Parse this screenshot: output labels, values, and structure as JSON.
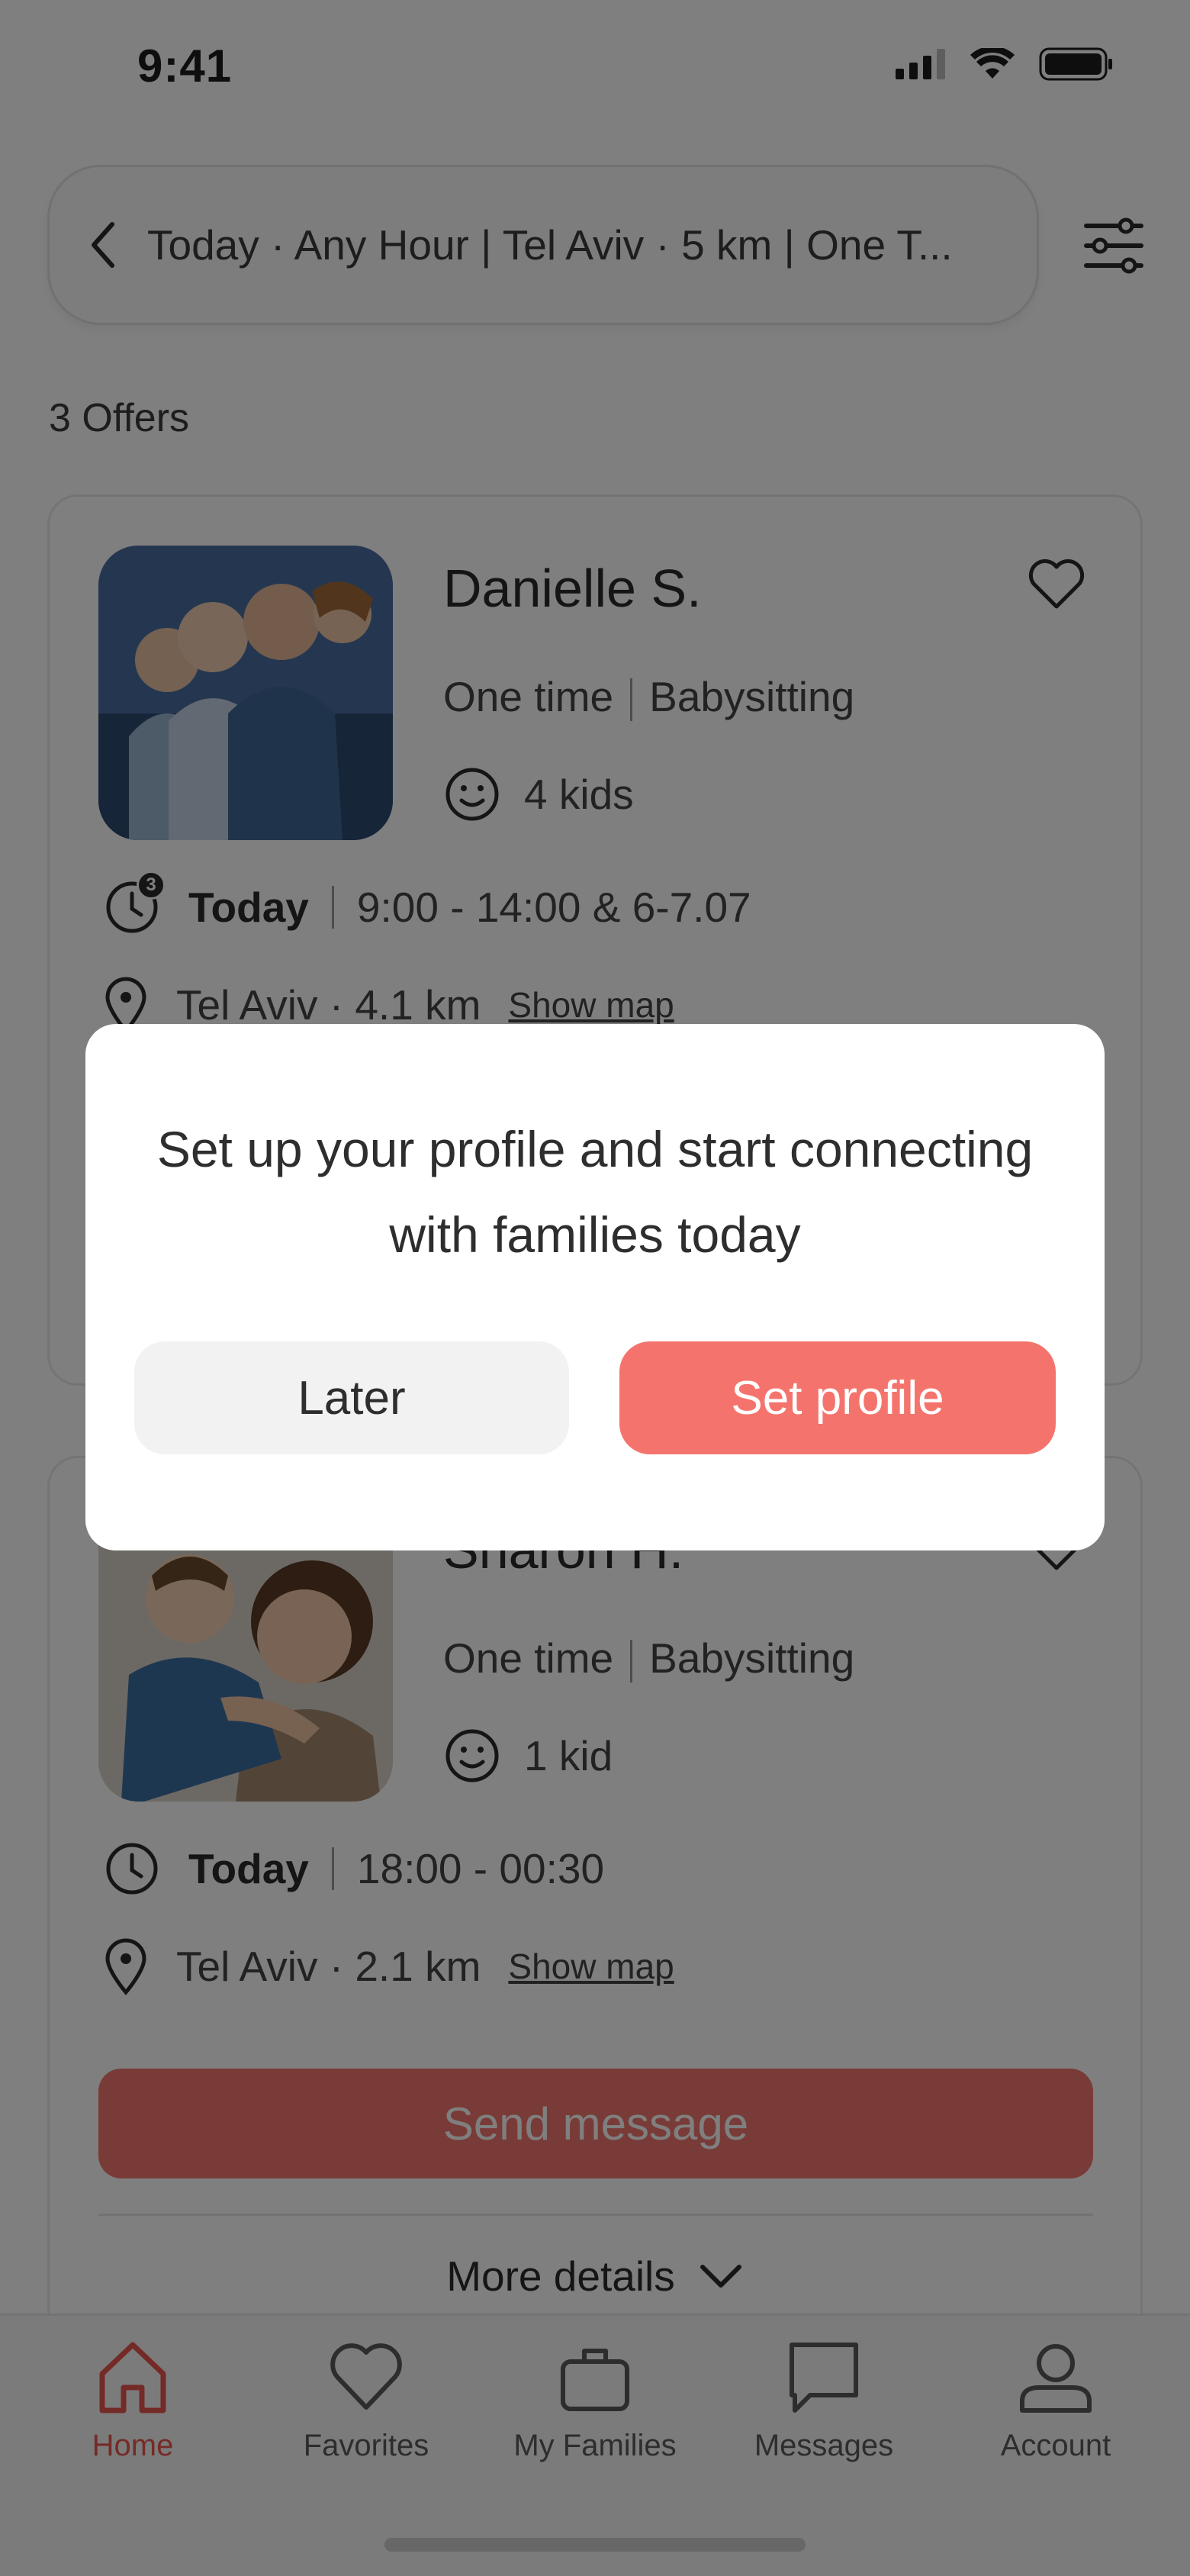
{
  "status_bar": {
    "time": "9:41"
  },
  "search": {
    "summary": "Today · Any Hour | Tel Aviv · 5 km | One T..."
  },
  "offers_count": "3 Offers",
  "cards": [
    {
      "name": "Danielle S.",
      "type": "One time",
      "service": "Babysitting",
      "kids": "4 kids",
      "day": "Today",
      "hours": "9:00 - 14:00 & 6-7.07",
      "time_badge": "3",
      "location": "Tel Aviv · 4.1 km",
      "show_map": "Show map"
    },
    {
      "name": "Sharon H.",
      "type": "One time",
      "service": "Babysitting",
      "kids": "1 kid",
      "day": "Today",
      "hours": "18:00 - 00:30",
      "location": "Tel Aviv · 2.1 km",
      "show_map": "Show map",
      "send_label": "Send message",
      "more_label": "More details"
    }
  ],
  "modal": {
    "message": "Set up your profile and start connecting with families today",
    "later_label": "Later",
    "set_profile_label": "Set profile"
  },
  "tabs": [
    {
      "label": "Home",
      "icon": "home-icon",
      "active": true
    },
    {
      "label": "Favorites",
      "icon": "heart-icon"
    },
    {
      "label": "My Families",
      "icon": "briefcase-icon"
    },
    {
      "label": "Messages",
      "icon": "message-icon"
    },
    {
      "label": "Account",
      "icon": "user-icon"
    }
  ],
  "colors": {
    "accent": "#f4746d",
    "active_tab": "#e8574f"
  }
}
